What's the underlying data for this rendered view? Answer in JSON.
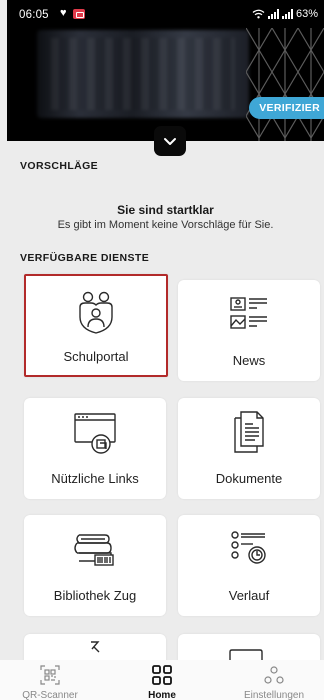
{
  "status_bar": {
    "time": "06:05",
    "battery": "63%"
  },
  "header": {
    "verify_label": "VERIFIZIER"
  },
  "suggestions": {
    "heading": "VORSCHLÄGE",
    "empty_title": "Sie sind startklar",
    "empty_text": "Es gibt im Moment keine Vorschläge für Sie."
  },
  "services": {
    "heading": "VERFÜGBARE DIENSTE",
    "tiles": [
      {
        "label": "Schulportal",
        "icon": "family-shield-icon",
        "selected": true
      },
      {
        "label": "News",
        "icon": "news-icon"
      },
      {
        "label": "Nützliche Links",
        "icon": "link-browser-icon"
      },
      {
        "label": "Dokumente",
        "icon": "documents-icon"
      },
      {
        "label": "Bibliothek Zug",
        "icon": "books-icon"
      },
      {
        "label": "Verlauf",
        "icon": "history-list-icon"
      }
    ]
  },
  "bottom_nav": {
    "items": [
      {
        "label": "QR-Scanner",
        "icon": "qr-code-icon",
        "active": false
      },
      {
        "label": "Home",
        "icon": "grid-icon",
        "active": true
      },
      {
        "label": "Einstellungen",
        "icon": "settings-dots-icon",
        "active": false
      }
    ]
  },
  "colors": {
    "accent": "#3fa7d6",
    "selection_border": "#b22a2a",
    "background": "#ececec"
  }
}
